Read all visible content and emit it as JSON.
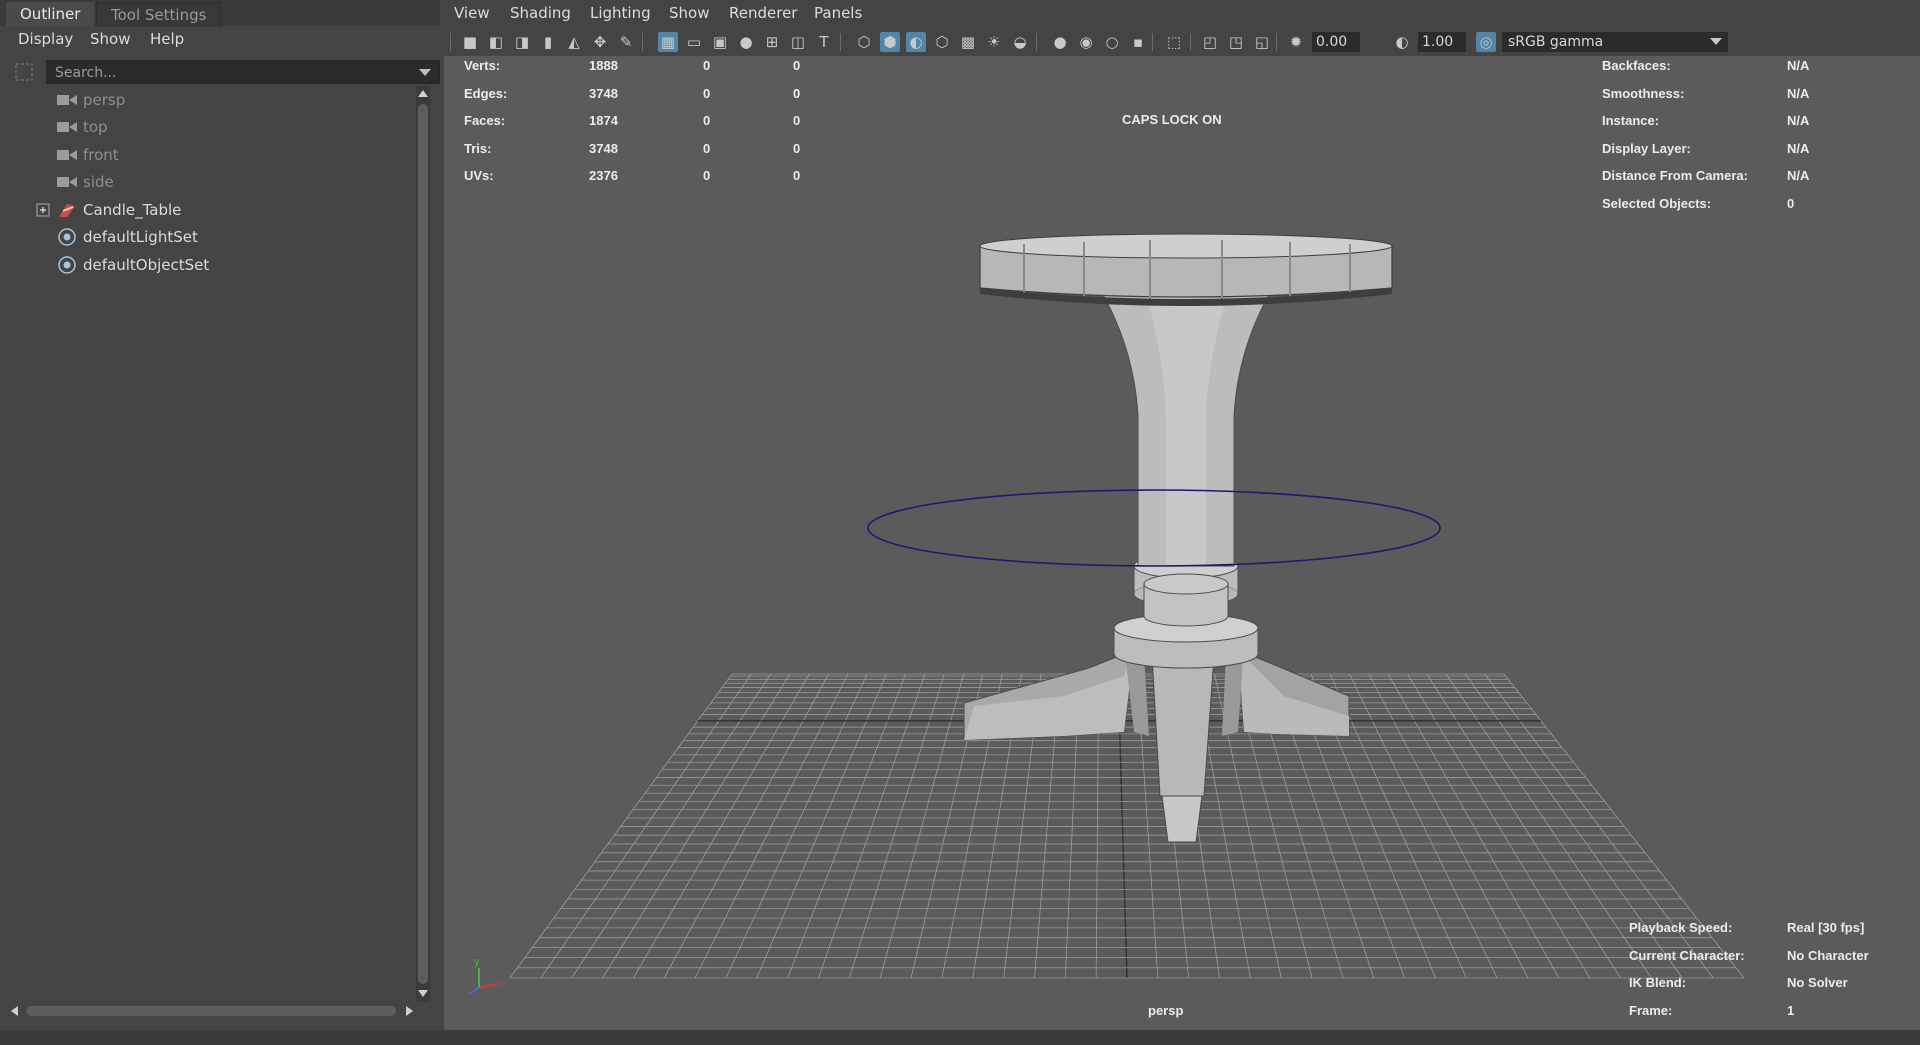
{
  "outliner": {
    "tabs": [
      {
        "label": "Outliner"
      },
      {
        "label": "Tool Settings"
      }
    ],
    "menu": [
      {
        "label": "Display"
      },
      {
        "label": "Show"
      },
      {
        "label": "Help"
      }
    ],
    "search": {
      "placeholder": "Search..."
    },
    "items": [
      {
        "label": "persp",
        "icon": "camera-icon"
      },
      {
        "label": "top",
        "icon": "camera-icon"
      },
      {
        "label": "front",
        "icon": "camera-icon"
      },
      {
        "label": "side",
        "icon": "camera-icon"
      },
      {
        "label": "Candle_Table",
        "icon": "transform-group-icon",
        "expand": "plus-box-icon"
      },
      {
        "label": "defaultLightSet",
        "icon": "set-icon"
      },
      {
        "label": "defaultObjectSet",
        "icon": "set-icon"
      }
    ]
  },
  "viewport": {
    "menu": [
      {
        "label": "View"
      },
      {
        "label": "Shading"
      },
      {
        "label": "Lighting"
      },
      {
        "label": "Show"
      },
      {
        "label": "Renderer"
      },
      {
        "label": "Panels"
      }
    ],
    "toolbar": {
      "field1": "0.00",
      "field2": "1.00",
      "gamma": "sRGB gamma"
    },
    "hud_left": [
      {
        "label": "Verts:",
        "v1": "1888",
        "v2": "0",
        "v3": "0"
      },
      {
        "label": "Edges:",
        "v1": "3748",
        "v2": "0",
        "v3": "0"
      },
      {
        "label": "Faces:",
        "v1": "1874",
        "v2": "0",
        "v3": "0"
      },
      {
        "label": "Tris:",
        "v1": "3748",
        "v2": "0",
        "v3": "0"
      },
      {
        "label": "UVs:",
        "v1": "2376",
        "v2": "0",
        "v3": "0"
      }
    ],
    "caps_lock": "CAPS LOCK ON",
    "hud_right": [
      {
        "label": "Backfaces:",
        "value": "N/A"
      },
      {
        "label": "Smoothness:",
        "value": "N/A"
      },
      {
        "label": "Instance:",
        "value": "N/A"
      },
      {
        "label": "Display Layer:",
        "value": "N/A"
      },
      {
        "label": "Distance From Camera:",
        "value": "N/A"
      },
      {
        "label": "Selected Objects:",
        "value": "0"
      }
    ],
    "hud_bottom": [
      {
        "label": "Playback Speed:",
        "value": "Real [30 fps]"
      },
      {
        "label": "Current Character:",
        "value": "No Character"
      },
      {
        "label": "IK Blend:",
        "value": "No Solver"
      },
      {
        "label": "Frame:",
        "value": "1"
      }
    ],
    "camera_name": "persp",
    "axis": {
      "y": "y",
      "x": "x"
    },
    "colors": {
      "background": "#5b5b5b",
      "model": "#bdbdbd",
      "grid": "#9a9a9a",
      "selection_ring": "#1a1a6e",
      "active_button": "#5285a6"
    }
  }
}
